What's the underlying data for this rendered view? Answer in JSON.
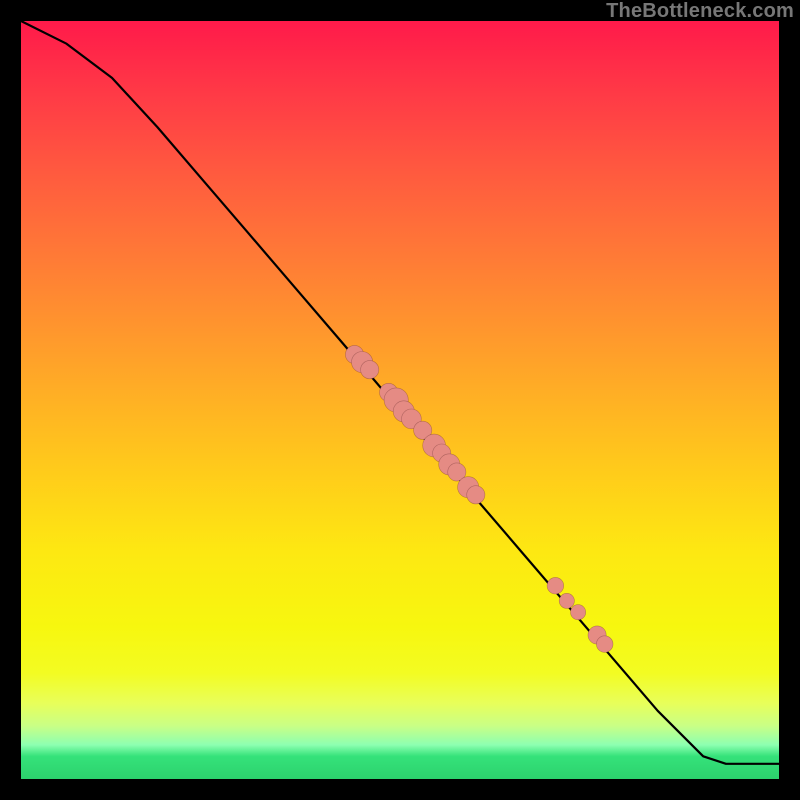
{
  "watermark": "TheBottleneck.com",
  "colors": {
    "dot_fill": "#e58b84",
    "curve_stroke": "#000000",
    "background": "#000000"
  },
  "chart_data": {
    "type": "line",
    "title": "",
    "xlabel": "",
    "ylabel": "",
    "xlim": [
      0,
      100
    ],
    "ylim": [
      0,
      100
    ],
    "grid": false,
    "legend": false,
    "series": [
      {
        "name": "curve",
        "x": [
          0,
          6,
          12,
          18,
          24,
          30,
          36,
          42,
          48,
          54,
          60,
          66,
          72,
          78,
          84,
          90,
          93,
          100
        ],
        "y": [
          100,
          97,
          92.5,
          86,
          79,
          72,
          65,
          58,
          51,
          44,
          37,
          30,
          23,
          16,
          9,
          3,
          2,
          2
        ]
      }
    ],
    "points": [
      {
        "name": "p1",
        "x": 44,
        "y": 56,
        "r": 1.2
      },
      {
        "name": "p2",
        "x": 45,
        "y": 55,
        "r": 1.4
      },
      {
        "name": "p3",
        "x": 46,
        "y": 54,
        "r": 1.2
      },
      {
        "name": "p4",
        "x": 48.5,
        "y": 51,
        "r": 1.2
      },
      {
        "name": "p5",
        "x": 49.5,
        "y": 50,
        "r": 1.6
      },
      {
        "name": "p6",
        "x": 50.5,
        "y": 48.5,
        "r": 1.4
      },
      {
        "name": "p7",
        "x": 51.5,
        "y": 47.5,
        "r": 1.3
      },
      {
        "name": "p8",
        "x": 53,
        "y": 46,
        "r": 1.2
      },
      {
        "name": "p9",
        "x": 54.5,
        "y": 44,
        "r": 1.5
      },
      {
        "name": "p10",
        "x": 55.5,
        "y": 43,
        "r": 1.2
      },
      {
        "name": "p11",
        "x": 56.5,
        "y": 41.5,
        "r": 1.4
      },
      {
        "name": "p12",
        "x": 57.5,
        "y": 40.5,
        "r": 1.2
      },
      {
        "name": "p13",
        "x": 59,
        "y": 38.5,
        "r": 1.4
      },
      {
        "name": "p14",
        "x": 60,
        "y": 37.5,
        "r": 1.2
      },
      {
        "name": "p15",
        "x": 70.5,
        "y": 25.5,
        "r": 1.1
      },
      {
        "name": "p16",
        "x": 72,
        "y": 23.5,
        "r": 1.0
      },
      {
        "name": "p17",
        "x": 73.5,
        "y": 22,
        "r": 1.0
      },
      {
        "name": "p18",
        "x": 76,
        "y": 19,
        "r": 1.2
      },
      {
        "name": "p19",
        "x": 77,
        "y": 17.8,
        "r": 1.1
      }
    ]
  }
}
